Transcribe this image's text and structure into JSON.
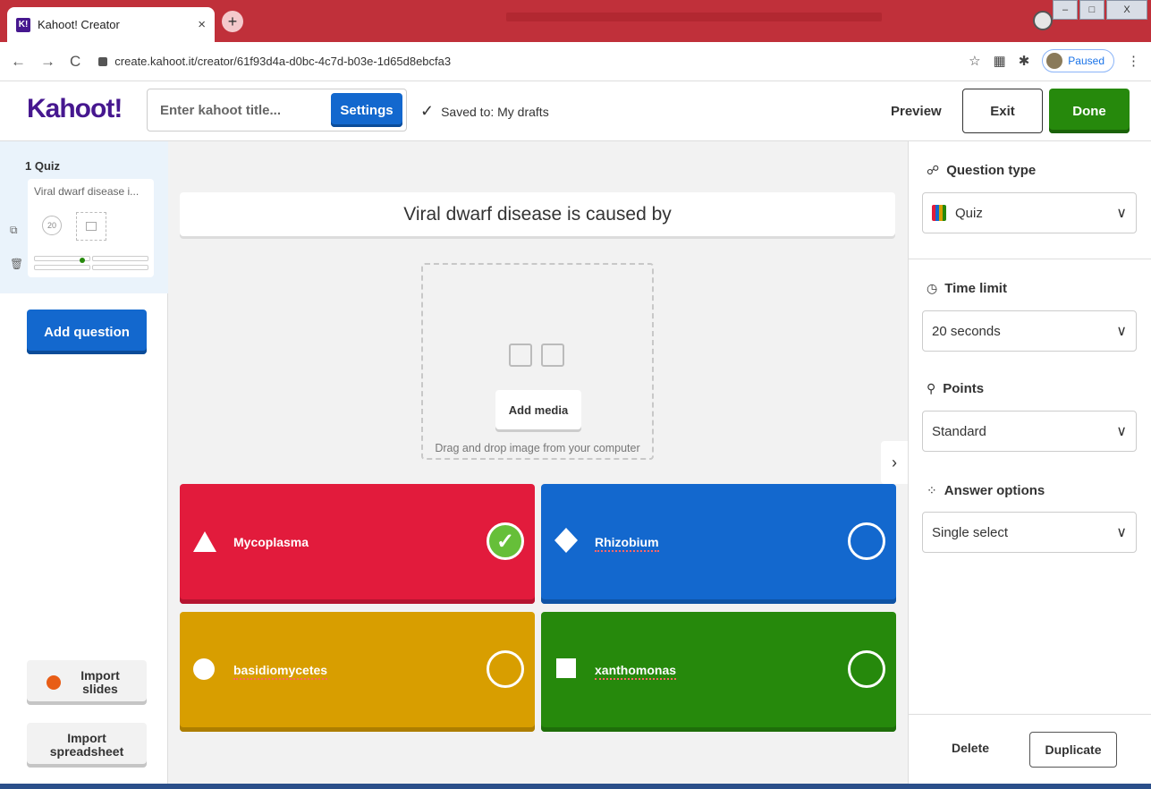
{
  "browser": {
    "tab_title": "Kahoot! Creator",
    "favicon_text": "K!",
    "tab_close": "×",
    "new_tab": "+",
    "url": "create.kahoot.it/creator/61f93d4a-d0bc-4c7d-b03e-1d65d8ebcfa3",
    "back": "←",
    "forward": "→",
    "reload": "C",
    "star": "☆",
    "paused_label": "Paused",
    "menu": "⋮",
    "min": "–",
    "max": "□",
    "close": "X"
  },
  "header": {
    "logo": "Kahoot!",
    "title_placeholder": "Enter kahoot title...",
    "settings_label": "Settings",
    "saved_check": "✓",
    "saved_text": "Saved to: My drafts",
    "preview_label": "Preview",
    "exit_label": "Exit",
    "done_label": "Done"
  },
  "sidebar": {
    "slide_number": "1",
    "slide_type": "Quiz",
    "slide_title": "Viral dwarf disease i...",
    "slide_timer": "20",
    "add_question": "Add question",
    "import_slides": "Import slides",
    "import_spreadsheet": "Import spreadsheet"
  },
  "question": {
    "title": "Viral dwarf disease is caused by",
    "add_media": "Add media",
    "media_hint": "Drag and drop image from your computer",
    "collapse_icon": "›",
    "answers": [
      {
        "text": "Mycoplasma",
        "color": "#e21b3c",
        "shape": "triangle",
        "correct": true
      },
      {
        "text": "Rhizobium",
        "color": "#1368ce",
        "shape": "diamond",
        "correct": false
      },
      {
        "text": "basidiomycetes",
        "color": "#d89e00",
        "shape": "circle",
        "correct": false
      },
      {
        "text": "xanthomonas",
        "color": "#26890c",
        "shape": "square",
        "correct": false
      }
    ],
    "correct_mark": "✓"
  },
  "panel": {
    "question_type_label": "Question type",
    "question_type_value": "Quiz",
    "time_limit_label": "Time limit",
    "time_limit_value": "20 seconds",
    "points_label": "Points",
    "points_value": "Standard",
    "answer_options_label": "Answer options",
    "answer_options_value": "Single select",
    "chevron": "∨",
    "delete_label": "Delete",
    "duplicate_label": "Duplicate"
  }
}
